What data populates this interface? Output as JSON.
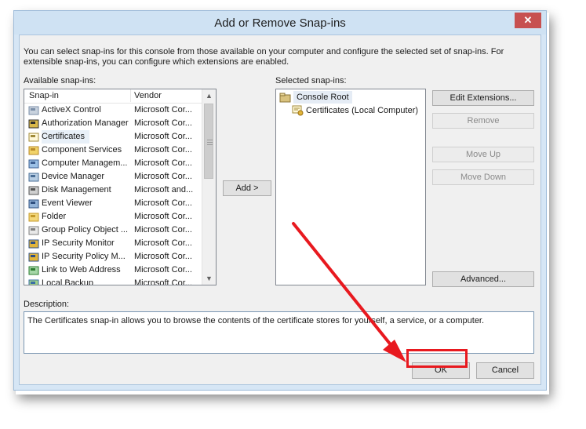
{
  "dialog": {
    "title": "Add or Remove Snap-ins",
    "close_glyph": "✕",
    "intro": "You can select snap-ins for this console from those available on your computer and configure the selected set of snap-ins. For extensible snap-ins, you can configure which extensions are enabled."
  },
  "available": {
    "label": "Available snap-ins:",
    "columns": [
      "Snap-in",
      "Vendor"
    ],
    "rows": [
      {
        "name": "ActiveX Control",
        "vendor": "Microsoft Cor...",
        "icon": "activex-icon"
      },
      {
        "name": "Authorization Manager",
        "vendor": "Microsoft Cor...",
        "icon": "authorization-icon"
      },
      {
        "name": "Certificates",
        "vendor": "Microsoft Cor...",
        "icon": "certificate-icon"
      },
      {
        "name": "Component Services",
        "vendor": "Microsoft Cor...",
        "icon": "component-services-icon"
      },
      {
        "name": "Computer Managem...",
        "vendor": "Microsoft Cor...",
        "icon": "computer-management-icon"
      },
      {
        "name": "Device Manager",
        "vendor": "Microsoft Cor...",
        "icon": "device-manager-icon"
      },
      {
        "name": "Disk Management",
        "vendor": "Microsoft and...",
        "icon": "disk-management-icon"
      },
      {
        "name": "Event Viewer",
        "vendor": "Microsoft Cor...",
        "icon": "event-viewer-icon"
      },
      {
        "name": "Folder",
        "vendor": "Microsoft Cor...",
        "icon": "folder-icon"
      },
      {
        "name": "Group Policy Object ...",
        "vendor": "Microsoft Cor...",
        "icon": "group-policy-icon"
      },
      {
        "name": "IP Security Monitor",
        "vendor": "Microsoft Cor...",
        "icon": "ip-security-monitor-icon"
      },
      {
        "name": "IP Security Policy M...",
        "vendor": "Microsoft Cor...",
        "icon": "ip-security-policy-icon"
      },
      {
        "name": "Link to Web Address",
        "vendor": "Microsoft Cor...",
        "icon": "web-link-icon"
      },
      {
        "name": "Local Backup",
        "vendor": "Microsoft Cor...",
        "icon": "local-backup-icon"
      }
    ],
    "selected_row": "Certificates",
    "scroll_up": "▲",
    "scroll_down": "▼"
  },
  "add_button": "Add >",
  "selected": {
    "label": "Selected snap-ins:",
    "root": "Console Root",
    "child": "Certificates (Local Computer)"
  },
  "side_buttons": {
    "edit_extensions": "Edit Extensions...",
    "remove": "Remove",
    "move_up": "Move Up",
    "move_down": "Move Down",
    "advanced": "Advanced..."
  },
  "description": {
    "label": "Description:",
    "text": "The Certificates snap-in allows you to browse the contents of the certificate stores for yourself, a service, or a computer."
  },
  "footer": {
    "ok": "OK",
    "cancel": "Cancel"
  },
  "annotation": {
    "arrow_color": "#e8191f"
  }
}
